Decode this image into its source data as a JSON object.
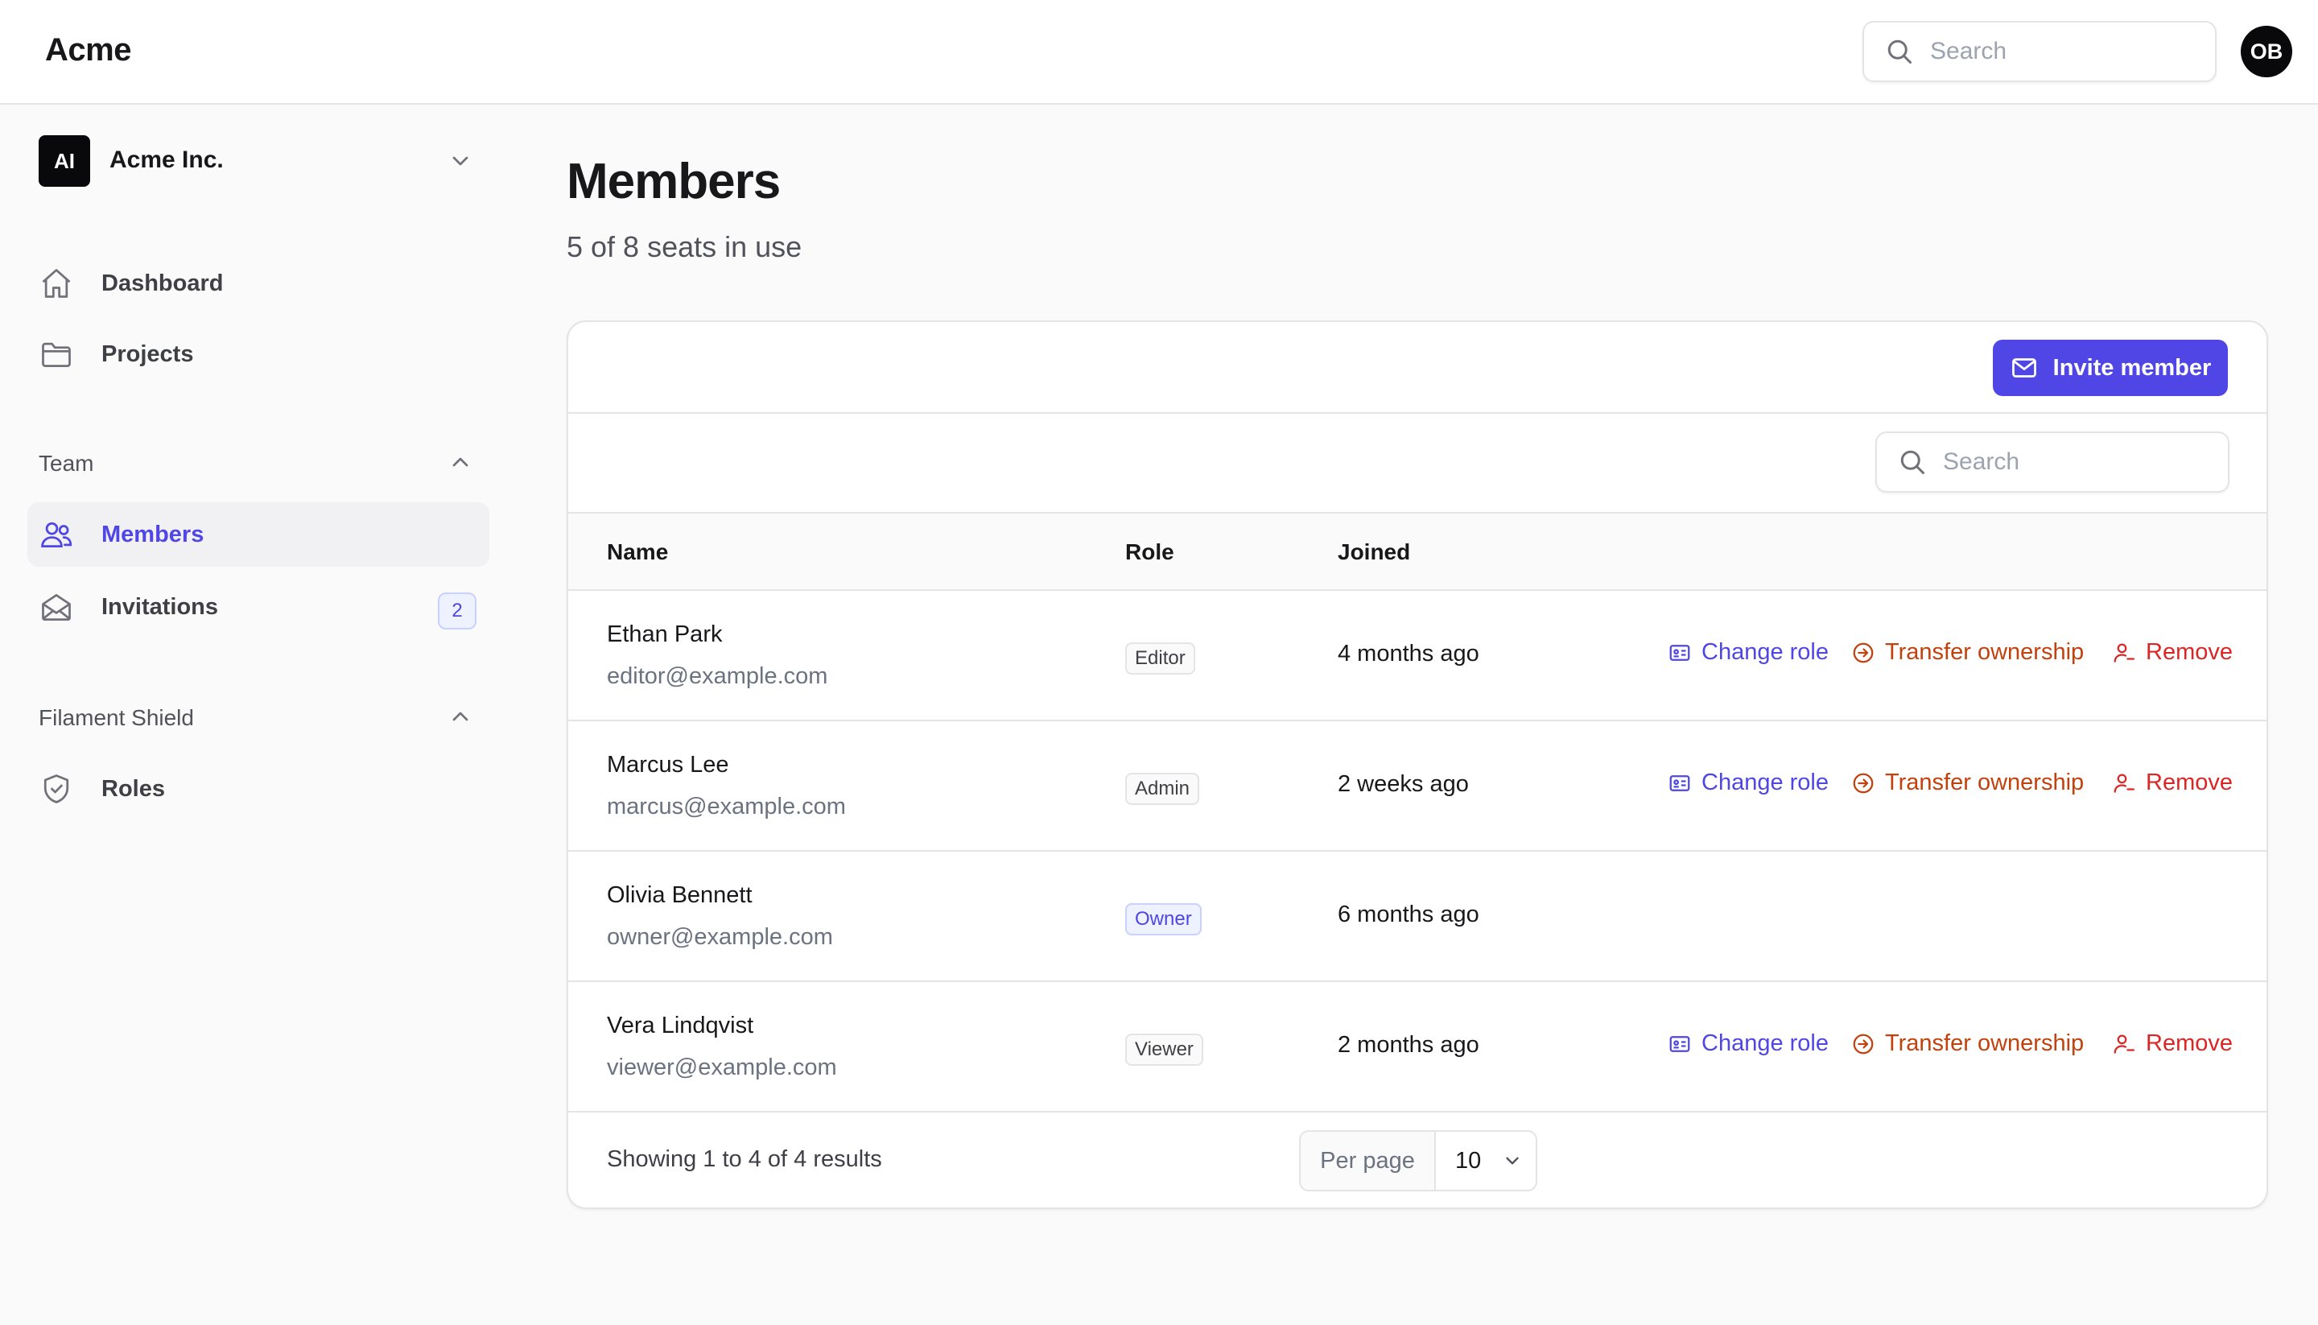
{
  "app": {
    "brand": "Acme"
  },
  "topbar": {
    "search_placeholder": "Search",
    "avatar_initials": "OB"
  },
  "tenant": {
    "initials": "AI",
    "name": "Acme Inc."
  },
  "sidebar": {
    "items": [
      {
        "label": "Dashboard",
        "icon": "home-icon"
      },
      {
        "label": "Projects",
        "icon": "folder-icon"
      }
    ],
    "groups": [
      {
        "label": "Team",
        "items": [
          {
            "label": "Members",
            "icon": "users-icon",
            "active": true
          },
          {
            "label": "Invitations",
            "icon": "envelope-open-icon",
            "badge": "2"
          }
        ]
      },
      {
        "label": "Filament Shield",
        "items": [
          {
            "label": "Roles",
            "icon": "shield-check-icon"
          }
        ]
      }
    ]
  },
  "page": {
    "title": "Members",
    "subtitle": "5 of 8 seats in use"
  },
  "card": {
    "invite_label": "Invite member",
    "search_placeholder": "Search",
    "columns": [
      "Name",
      "Role",
      "Joined"
    ],
    "rows": [
      {
        "name": "Ethan Park",
        "email": "editor@example.com",
        "role": "Editor",
        "joined": "4 months ago",
        "actions": true
      },
      {
        "name": "Marcus Lee",
        "email": "marcus@example.com",
        "role": "Admin",
        "joined": "2 weeks ago",
        "actions": true
      },
      {
        "name": "Olivia Bennett",
        "email": "owner@example.com",
        "role": "Owner",
        "joined": "6 months ago",
        "actions": false
      },
      {
        "name": "Vera Lindqvist",
        "email": "viewer@example.com",
        "role": "Viewer",
        "joined": "2 months ago",
        "actions": true
      }
    ],
    "actions": {
      "change_role": "Change role",
      "transfer": "Transfer ownership",
      "remove": "Remove"
    },
    "footer": {
      "showing": "Showing 1 to 4 of 4 results",
      "per_page_label": "Per page",
      "per_page_value": "10"
    }
  },
  "colors": {
    "primary": "#4f46e5",
    "warning": "#c2410c",
    "danger": "#dc2626"
  }
}
